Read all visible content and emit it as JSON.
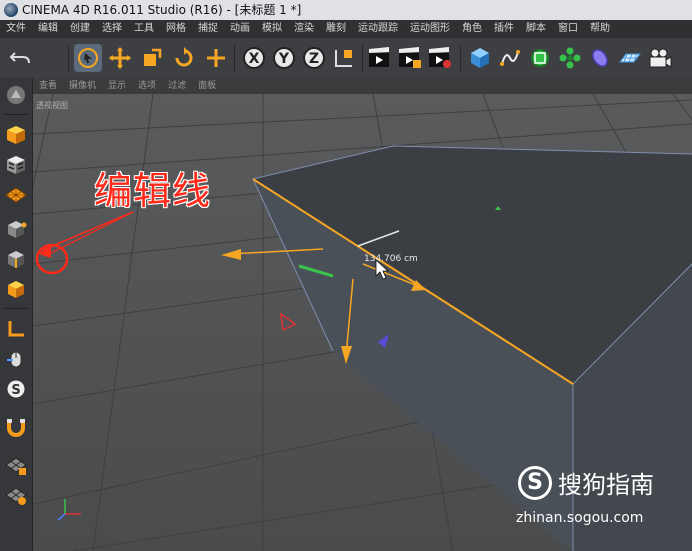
{
  "window": {
    "title": "CINEMA 4D R16.011 Studio (R16) - [未标题 1 *]"
  },
  "menu": [
    "文件",
    "编辑",
    "创建",
    "选择",
    "工具",
    "网格",
    "捕捉",
    "动画",
    "模拟",
    "渲染",
    "雕刻",
    "运动跟踪",
    "运动图形",
    "角色",
    "插件",
    "脚本",
    "窗口",
    "帮助"
  ],
  "toolbar": {
    "axis_x": "X",
    "axis_y": "Y",
    "axis_z": "Z"
  },
  "view_menu": [
    "查看",
    "摄像机",
    "显示",
    "选项",
    "过滤",
    "面板"
  ],
  "viewport": {
    "label": "透视视图",
    "measure": "134.706 cm"
  },
  "annotation": {
    "text": "编辑线",
    "color": "#ff2a1a"
  },
  "watermark": {
    "brand": "搜狗指南",
    "url": "zhinan.sogou.com"
  },
  "colors": {
    "accent_orange": "#f5a623",
    "selection_blue": "#5b6a7c"
  },
  "icons": {
    "undo": "undo-icon",
    "live_select": "live-selection-icon",
    "move": "move-icon",
    "scale": "scale-icon",
    "rotate": "rotate-icon",
    "add": "add-icon",
    "coord": "coordinate-system-icon",
    "render": "render-view-icon",
    "cube": "cube-primitive-icon",
    "pen": "spline-pen-icon",
    "subdiv": "subdivision-icon",
    "array": "array-icon",
    "deformer": "deformer-icon",
    "floor": "floor-icon",
    "camera": "camera-icon"
  }
}
